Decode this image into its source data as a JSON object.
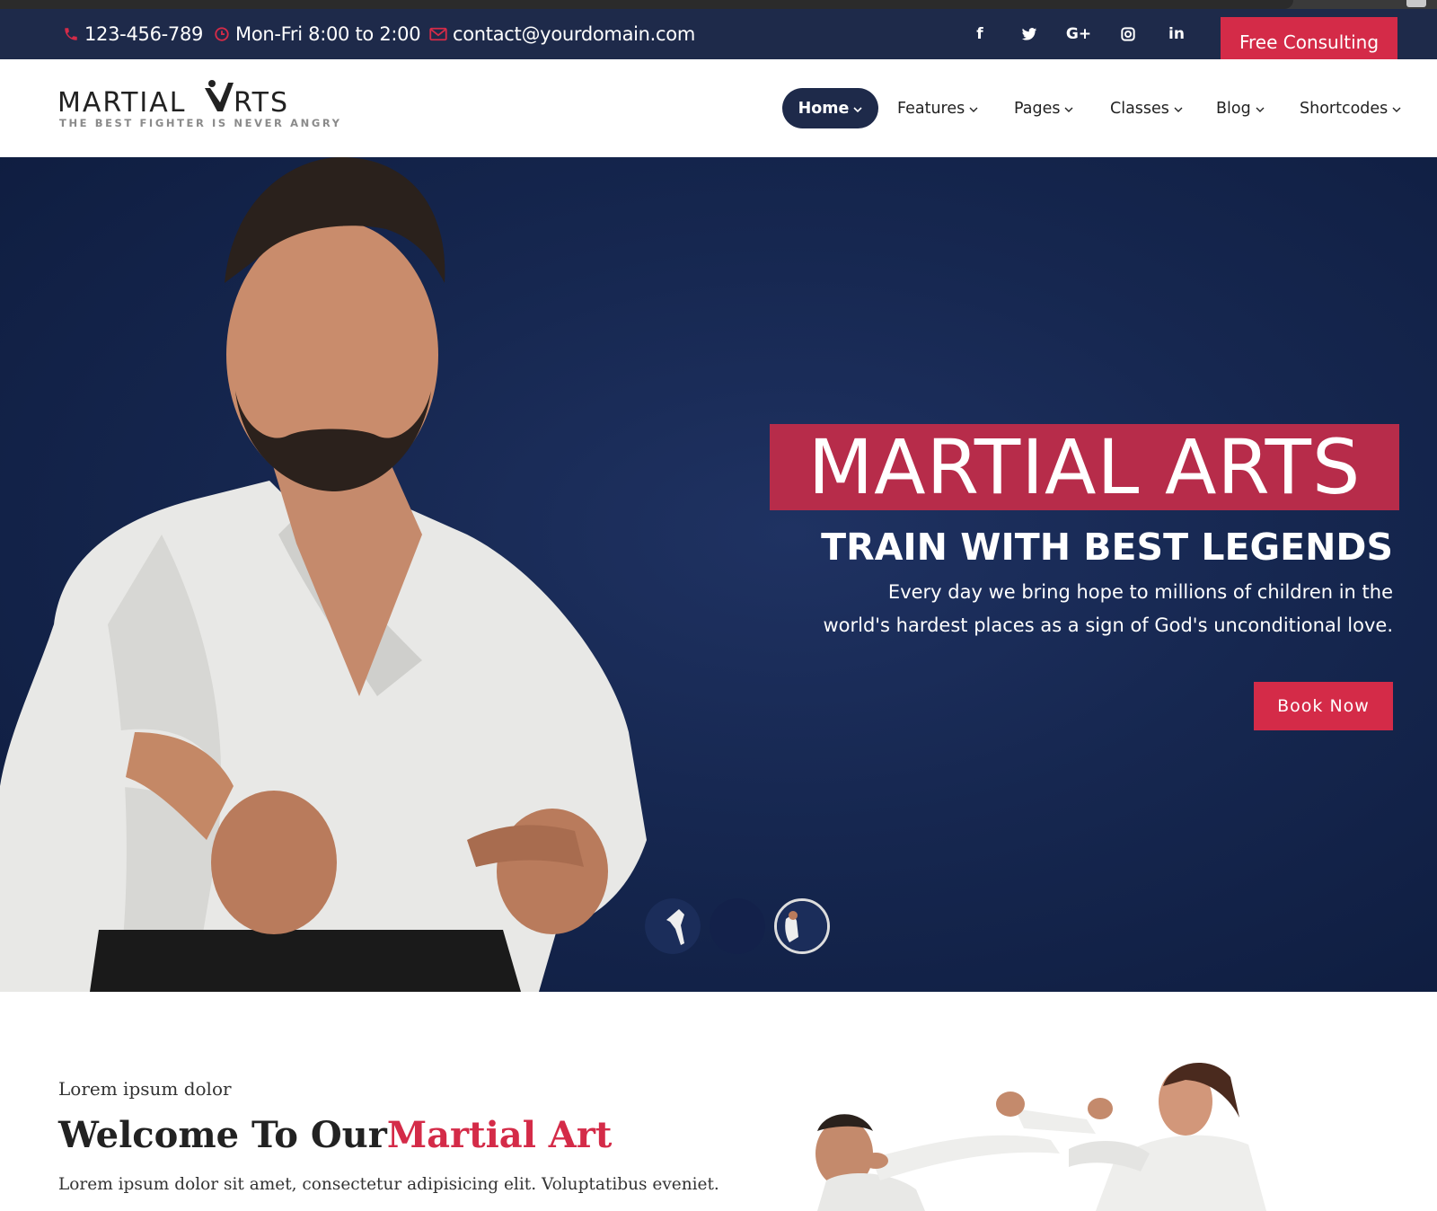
{
  "topbar": {
    "phone": "123-456-789",
    "hours": "Mon-Fri 8:00 to 2:00",
    "email": "contact@yourdomain.com",
    "social": {
      "facebook": "f",
      "twitter": "twitter",
      "google_plus": "G+",
      "instagram": "instagram",
      "linkedin": "in"
    },
    "cta_label": "Free Consulting"
  },
  "header": {
    "logo_text": "MARTIAL ARTS",
    "logo_tagline": "THE BEST FIGHTER IS NEVER ANGRY",
    "nav": [
      {
        "label": "Home",
        "active": true
      },
      {
        "label": "Features",
        "active": false
      },
      {
        "label": "Pages",
        "active": false
      },
      {
        "label": "Classes",
        "active": false
      },
      {
        "label": "Blog",
        "active": false
      },
      {
        "label": "Shortcodes",
        "active": false
      }
    ]
  },
  "hero": {
    "title": "MARTIAL ARTS",
    "subtitle": "TRAIN WITH BEST LEGENDS",
    "description": "Every day we bring hope to millions of children in the world's hardest places as a sign of God's unconditional love.",
    "button_label": "Book Now",
    "slides_count": 3,
    "active_slide": 3
  },
  "welcome": {
    "kicker": "Lorem ipsum dolor",
    "title_main": "Welcome To Our",
    "title_accent": "Martial Art",
    "text": "Lorem ipsum dolor sit amet, consectetur adipisicing elit. Voluptatibus eveniet."
  },
  "colors": {
    "navy": "#1e2a4a",
    "accent_red": "#d42b48",
    "hero_title_bg": "#b72c4a",
    "hero_bg": "#162750"
  }
}
